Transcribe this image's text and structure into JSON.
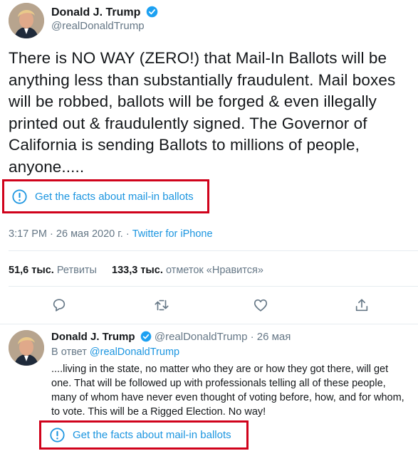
{
  "main_tweet": {
    "author_name": "Donald J. Trump",
    "author_handle": "@realDonaldTrump",
    "text": "There is NO WAY (ZERO!) that Mail-In Ballots will be anything less than substantially fraudulent. Mail boxes will be robbed, ballots will be forged & even illegally printed out & fraudulently signed. The Governor of California is sending Ballots to millions of people, anyone.....",
    "facts_label": "Get the facts about mail-in ballots",
    "time": "3:17 PM",
    "date": "26 мая 2020 г.",
    "separator": "·",
    "source": "Twitter for iPhone",
    "retweets_count": "51,6 тыс.",
    "retweets_label": "Ретвиты",
    "likes_count": "133,3 тыс.",
    "likes_label": "отметок «Нравится»"
  },
  "actions": {
    "reply_icon": "reply-icon",
    "retweet_icon": "retweet-icon",
    "like_icon": "heart-icon",
    "share_icon": "share-icon"
  },
  "reply_tweet": {
    "author_name": "Donald J. Trump",
    "author_handle": "@realDonaldTrump",
    "separator": "·",
    "date": "26 мая",
    "reply_prefix": "В ответ",
    "reply_to": "@realDonaldTrump",
    "text": "....living in the state, no matter who they are or how they got there, will get one. That will be followed up with professionals telling all of these people, many of whom have never even thought of voting before, how, and for whom, to vote. This will be a Rigged Election. No way!",
    "facts_label": "Get the facts about mail-in ballots"
  },
  "colors": {
    "accent": "#1b95e0",
    "highlight_box": "#d0021b",
    "secondary_text": "#657786"
  }
}
